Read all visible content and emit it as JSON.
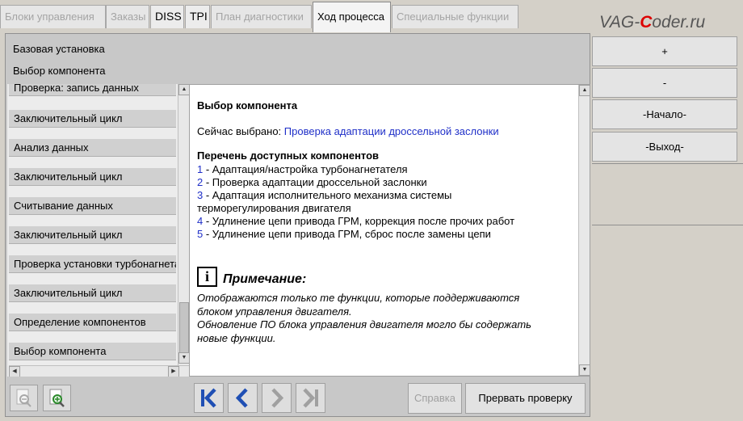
{
  "tabs": [
    {
      "label": "Блоки управления",
      "state": "disabled"
    },
    {
      "label": "Заказы",
      "state": "disabled"
    },
    {
      "label": "DISS",
      "state": "enabled"
    },
    {
      "label": "TPI",
      "state": "enabled"
    },
    {
      "label": "План диагностики",
      "state": "disabled"
    },
    {
      "label": "Ход процесса",
      "state": "active"
    },
    {
      "label": "Специальные функции",
      "state": "disabled"
    }
  ],
  "watermark": {
    "prefix": "VAG-",
    "accent": "C",
    "suffix": "oder.ru"
  },
  "header": {
    "line1": "Базовая установка",
    "line2": "Выбор компонента"
  },
  "steps": [
    "Проверка: запись данных",
    "Заключительный цикл",
    "Анализ данных",
    "Заключительный цикл",
    "Считывание данных",
    "Заключительный цикл",
    "Проверка установки турбонагнетателя",
    "Заключительный цикл",
    "Определение компонентов",
    "Выбор компонента"
  ],
  "content": {
    "title": "Выбор компонента",
    "selected_label": "Сейчас выбрано: ",
    "selected_value": "Проверка адаптации дроссельной заслонки",
    "list_heading": "Перечень доступных компонентов",
    "items": [
      {
        "num": "1",
        "text": " - Адаптация/настройка турбонагнетателя"
      },
      {
        "num": "2",
        "text": " - Проверка адаптации дроссельной заслонки"
      },
      {
        "num": "3",
        "text": " - Адаптация исполнительного механизма системы терморегулирования двигателя"
      },
      {
        "num": "4",
        "text": " - Удлинение цепи привода ГРМ, коррекция после прочих работ"
      },
      {
        "num": "5",
        "text": " - Удлинение цепи привода ГРМ, сброс после замены цепи"
      }
    ],
    "note_heading": "Примечание:",
    "note_line1": "Отображаются только те функции, которые поддерживаются блоком управления двигателя.",
    "note_line2": "Обновление ПО блока управления двигателя могло бы содержать новые функции."
  },
  "toolbar": {
    "help_label": "Справка",
    "abort_label": "Прервать проверку"
  },
  "right_buttons": {
    "plus": "+",
    "minus": "-",
    "start": "-Начало-",
    "exit": "-Выход-"
  },
  "colors": {
    "link": "#1f2fc8",
    "nav_active": "#1f4fb4",
    "nav_disabled": "#a0a0a0",
    "watermark_accent": "#dd0000"
  },
  "icons": [
    "zoom-out-icon",
    "zoom-in-icon",
    "first-page-icon",
    "previous-icon",
    "next-icon",
    "last-page-icon",
    "info-icon"
  ]
}
